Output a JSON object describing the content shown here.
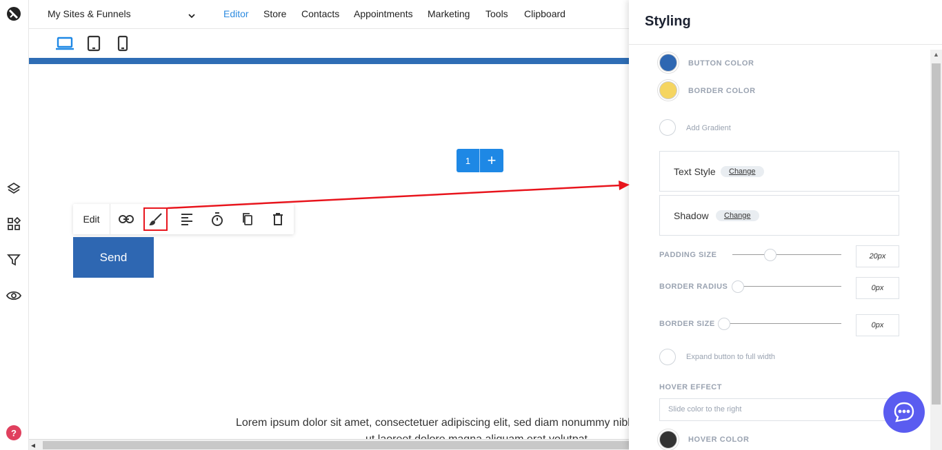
{
  "topnav": {
    "site_select": "My Sites & Funnels",
    "items": [
      "Editor",
      "Store",
      "Contacts",
      "Appointments",
      "Marketing",
      "Tools",
      "Clipboard"
    ],
    "active": "Editor"
  },
  "devices": [
    "laptop-icon",
    "tablet-icon",
    "phone-icon"
  ],
  "canvas": {
    "row_number": "1",
    "row_add": "+",
    "toolbar": {
      "edit_label": "Edit",
      "icons": [
        "link-icon",
        "brush-icon",
        "align-left-icon",
        "timer-icon",
        "copy-icon",
        "trash-icon"
      ]
    },
    "button_label": "Send",
    "lorem_line1": "Lorem ipsum dolor sit amet, consectetuer adipiscing elit, sed diam nonummy nibh euismod tincidunt",
    "lorem_line2": "ut laoreet dolore magna aliquam erat volutpat."
  },
  "panel": {
    "title": "Styling",
    "button_color_label": "BUTTON COLOR",
    "button_color": "#2e67b2",
    "border_color_label": "BORDER COLOR",
    "border_color": "#f5d561",
    "add_gradient_label": "Add Gradient",
    "text_style_label": "Text Style",
    "text_style_change": "Change",
    "shadow_label": "Shadow",
    "shadow_change": "Change",
    "padding_label": "PADDING SIZE",
    "padding_value": "20px",
    "padding_level": 0.35,
    "radius_label": "BORDER RADIUS",
    "radius_value": "0px",
    "radius_level": 0,
    "border_size_label": "BORDER SIZE",
    "border_size_value": "0px",
    "border_size_level": 0,
    "expand_label": "Expand button to full width",
    "hover_effect_label": "HOVER EFFECT",
    "hover_effect_value": "Slide color to the right",
    "hover_color_label": "HOVER COLOR",
    "hover_color": "#333333"
  },
  "help_label": "?",
  "colors": {
    "accent": "#1e88e5",
    "annotation": "#e8141c",
    "chat": "#5a5cf0"
  }
}
